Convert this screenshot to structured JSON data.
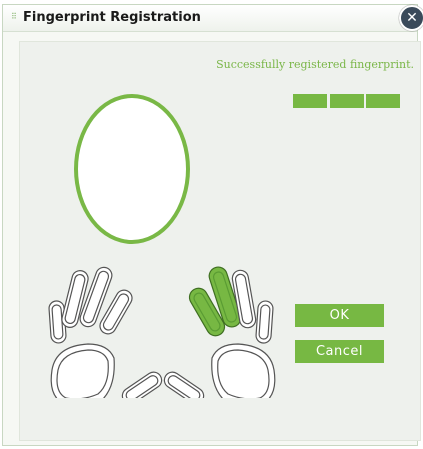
{
  "dialog": {
    "title": "Fingerprint Registration",
    "close_glyph": "✕",
    "grip_glyph": "⠿"
  },
  "status": {
    "message": "Successfully registered fingerprint.",
    "progress_segments_filled": 3,
    "progress_segments_total": 3
  },
  "fingers": {
    "left": [
      "left-pinky",
      "left-ring",
      "left-middle",
      "left-index",
      "left-thumb"
    ],
    "right": [
      "right-thumb",
      "right-index",
      "right-middle",
      "right-ring",
      "right-pinky"
    ],
    "registered": [
      "right-index",
      "right-middle"
    ]
  },
  "buttons": {
    "ok": "OK",
    "cancel": "Cancel"
  },
  "colors": {
    "accent": "#77b843",
    "finger_outline": "#555555"
  },
  "icons": {
    "close": "close-icon",
    "grip": "grip-icon"
  }
}
